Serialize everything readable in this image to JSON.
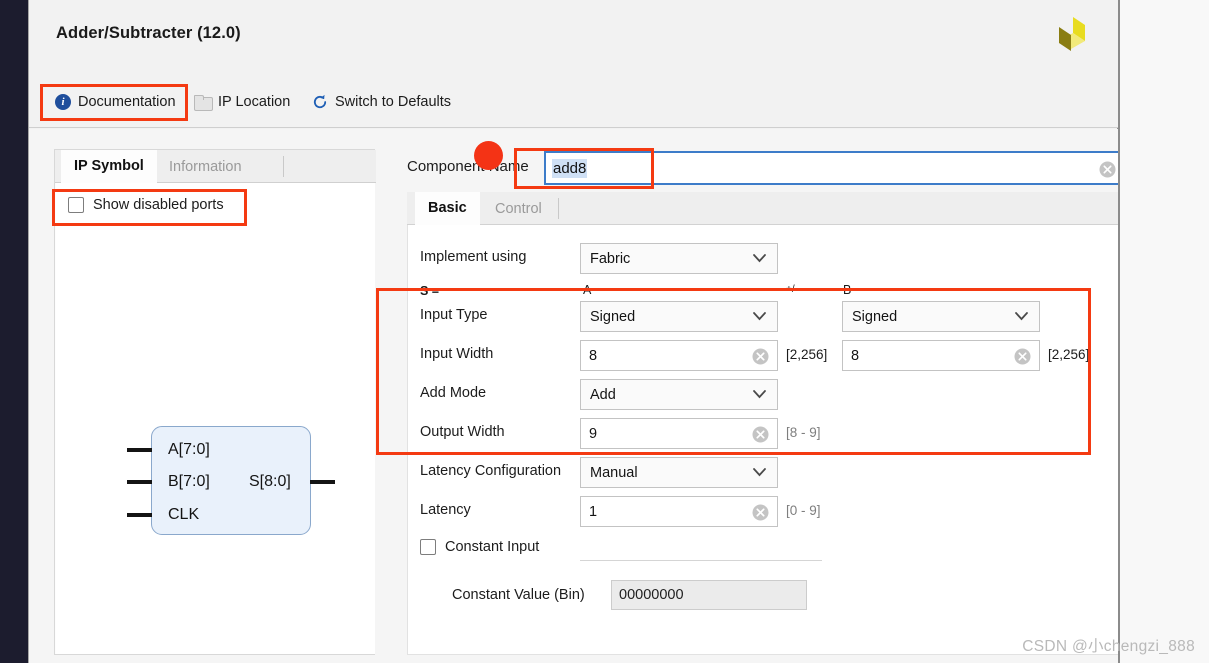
{
  "window": {
    "title": "Adder/Subtracter (12.0)",
    "logo_icon": "xilinx-logo-icon"
  },
  "toolbar": {
    "documentation": {
      "label": "Documentation",
      "icon": "info-icon"
    },
    "ip_location": {
      "label": "IP Location",
      "icon": "folder-icon"
    },
    "switch_defaults": {
      "label": "Switch to Defaults",
      "icon": "refresh-icon"
    }
  },
  "left_panel": {
    "tabs": [
      {
        "label": "IP Symbol",
        "active": true
      },
      {
        "label": "Information",
        "active": false
      }
    ],
    "show_disabled_ports": {
      "label": "Show disabled ports",
      "checked": false
    },
    "symbol": {
      "inputs": [
        "A[7:0]",
        "B[7:0]",
        "CLK"
      ],
      "outputs": [
        "S[8:0]"
      ]
    }
  },
  "component_name": {
    "label": "Component Name",
    "value": "add8",
    "clear_icon": "clear-icon"
  },
  "config_tabs": [
    {
      "label": "Basic",
      "active": true
    },
    {
      "label": "Control",
      "active": false
    }
  ],
  "form": {
    "implement_using": {
      "label": "Implement using",
      "value": "Fabric"
    },
    "column_headers": {
      "result": "S =",
      "operand_a": "A",
      "operator": "+/-",
      "operand_b": "B"
    },
    "input_type": {
      "label": "Input Type",
      "value_a": "Signed",
      "value_b": "Signed"
    },
    "input_width": {
      "label": "Input Width",
      "value_a": "8",
      "range_a": "[2,256]",
      "value_b": "8",
      "range_b": "[2,256]"
    },
    "add_mode": {
      "label": "Add Mode",
      "value": "Add"
    },
    "output_width": {
      "label": "Output Width",
      "value": "9",
      "range": "[8 - 9]"
    },
    "latency_configuration": {
      "label": "Latency Configuration",
      "value": "Manual"
    },
    "latency": {
      "label": "Latency",
      "value": "1",
      "range": "[0 - 9]"
    },
    "constant_input": {
      "label": "Constant Input",
      "checked": false
    },
    "constant_value": {
      "label": "Constant Value (Bin)",
      "value": "00000000"
    }
  },
  "annotations": {
    "color": "#f43a12",
    "dot_color": "#f43315",
    "boxes": [
      "documentation-button",
      "show-disabled-ports",
      "component-name-value",
      "basic-fields-group"
    ]
  },
  "watermark": "CSDN @小chengzi_888"
}
